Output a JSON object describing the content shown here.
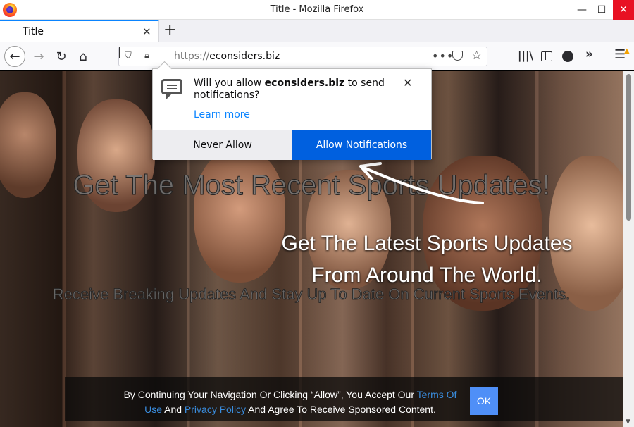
{
  "window": {
    "title": "Title - Mozilla Firefox",
    "min_glyph": "—",
    "max_glyph": "☐",
    "close_glyph": "✕"
  },
  "tab": {
    "title": "Title",
    "close_glyph": "✕",
    "new_tab_glyph": "+"
  },
  "nav": {
    "back_glyph": "←",
    "forward_glyph": "→",
    "reload_glyph": "↻",
    "home_glyph": "⌂",
    "url_protocol": "https://",
    "url_host": "econsiders.biz",
    "page_actions_glyph": "•••",
    "star_glyph": "☆",
    "library_glyph": "|||\\",
    "overflow_glyph": "»",
    "menu_glyph": "☰",
    "warn_glyph": "▲"
  },
  "popup": {
    "msg_before": "Will you allow ",
    "msg_host": "econsiders.biz",
    "msg_after": " to send notifications?",
    "close_glyph": "✕",
    "learn_more": "Learn more",
    "never_allow": "Never Allow",
    "allow": "Allow Notifications"
  },
  "page": {
    "headline": "Get The Most Recent Sports Updates!",
    "sub_line1": "Get The Latest Sports Updates",
    "sub_line2": "From Around The World.",
    "small_text": "Receive Breaking Updates And Stay Up To Date On Current Sports Events."
  },
  "cookie": {
    "text1": "By Continuing Your Navigation Or Clicking “Allow”, You Accept Our ",
    "terms_link": "Terms Of Use",
    "text2": " And ",
    "privacy_link": "Privacy Policy",
    "text3": " And Agree To Receive Sponsored Content.",
    "ok": "OK"
  },
  "colors": {
    "accent": "#0a84ff",
    "allow_button": "#0060df",
    "ok_button": "#4f8ff7",
    "close_red": "#e81123"
  }
}
